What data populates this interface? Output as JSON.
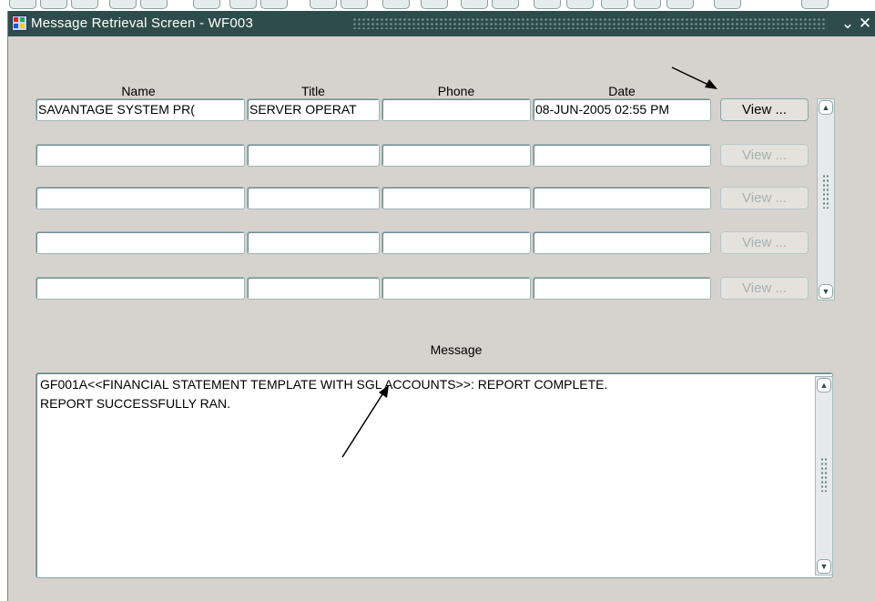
{
  "window": {
    "title": "Message Retrieval Screen - WF003",
    "controls": {
      "minimize": "⌄",
      "close": "✕"
    }
  },
  "columns": {
    "name": "Name",
    "title": "Title",
    "phone": "Phone",
    "date": "Date"
  },
  "rows": [
    {
      "name": "SAVANTAGE SYSTEM PR(",
      "title": "SERVER OPERAT",
      "phone": "",
      "date": "08-JUN-2005  02:55 PM",
      "view_label": "View ...",
      "view_enabled": true
    },
    {
      "name": "",
      "title": "",
      "phone": "",
      "date": "",
      "view_label": "View ...",
      "view_enabled": false
    },
    {
      "name": "",
      "title": "",
      "phone": "",
      "date": "",
      "view_label": "View ...",
      "view_enabled": false
    },
    {
      "name": "",
      "title": "",
      "phone": "",
      "date": "",
      "view_label": "View ...",
      "view_enabled": false
    },
    {
      "name": "",
      "title": "",
      "phone": "",
      "date": "",
      "view_label": "View ...",
      "view_enabled": false
    }
  ],
  "message_section": {
    "label": "Message",
    "lines": [
      "GF001A<<FINANCIAL STATEMENT TEMPLATE WITH SGL ACCOUNTS>>:  REPORT COMPLETE.",
      "REPORT SUCCESSFULLY RAN."
    ]
  },
  "icons": {
    "app": "form-window-icon",
    "scroll_up": "scroll-up-arrow-icon",
    "scroll_down": "scroll-down-arrow-icon",
    "annotations": "pointer-arrow-icon"
  },
  "colors": {
    "titlebar": "#2f4c4c",
    "window_bg": "#d6d3ce",
    "field_border": "#a0b4b4",
    "disabled_text": "#a8b0b0"
  }
}
